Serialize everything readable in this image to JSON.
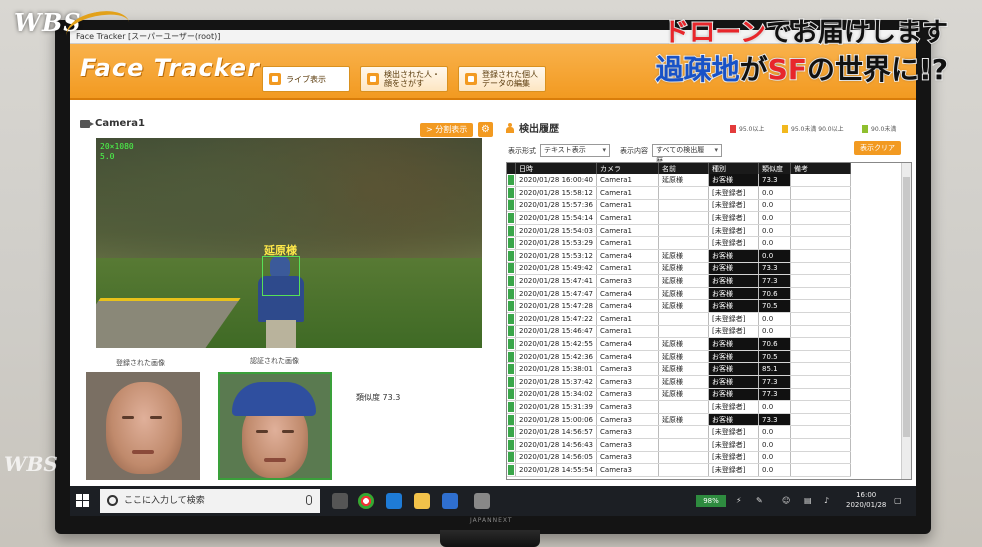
{
  "window": {
    "title": "Face Tracker [スーパーユーザー(root)]"
  },
  "app": {
    "logo": "Face Tracker"
  },
  "nav": [
    {
      "label": "ライブ表示"
    },
    {
      "label": "検出された人・顔をさがす"
    },
    {
      "label": "登録された個人データの編集"
    }
  ],
  "camera": {
    "title": "Camera1",
    "split_label": "> 分割表示",
    "resolution": "20×1080",
    "fps": "5.0",
    "detected_name": "延原様"
  },
  "thumbnails": {
    "registered_label": "登録された画像",
    "detected_label": "認証された画像",
    "similarity_text": "類似度 73.3"
  },
  "history": {
    "title": "検出履歴",
    "legend": [
      {
        "label": "95.0以上",
        "color": "#e33b3b"
      },
      {
        "label": "95.0未満 90.0以上",
        "color": "#f2b81e"
      },
      {
        "label": "90.0未満",
        "color": "#8fbf2f"
      }
    ],
    "display_format_label": "表示形式",
    "display_format_value": "テキスト表示",
    "display_content_label": "表示内容",
    "display_content_value": "すべての検出履歴",
    "clear_label": "表示クリア",
    "columns": [
      "日時",
      "カメラ",
      "名前",
      "種別",
      "類似度",
      "備考"
    ],
    "rows": [
      [
        "2020/01/28 16:00:40",
        "Camera1",
        "延原様",
        "お客様",
        "73.3",
        ""
      ],
      [
        "2020/01/28 15:58:12",
        "Camera1",
        "",
        "[未登録者]",
        "0.0",
        ""
      ],
      [
        "2020/01/28 15:57:36",
        "Camera1",
        "",
        "[未登録者]",
        "0.0",
        ""
      ],
      [
        "2020/01/28 15:54:14",
        "Camera1",
        "",
        "[未登録者]",
        "0.0",
        ""
      ],
      [
        "2020/01/28 15:54:03",
        "Camera1",
        "",
        "[未登録者]",
        "0.0",
        ""
      ],
      [
        "2020/01/28 15:53:29",
        "Camera1",
        "",
        "[未登録者]",
        "0.0",
        ""
      ],
      [
        "2020/01/28 15:53:12",
        "Camera4",
        "延原様",
        "お客様",
        "0.0",
        ""
      ],
      [
        "2020/01/28 15:49:42",
        "Camera1",
        "延原様",
        "お客様",
        "73.3",
        ""
      ],
      [
        "2020/01/28 15:47:41",
        "Camera3",
        "延原様",
        "お客様",
        "77.3",
        ""
      ],
      [
        "2020/01/28 15:47:47",
        "Camera4",
        "延原様",
        "お客様",
        "70.6",
        ""
      ],
      [
        "2020/01/28 15:47:28",
        "Camera4",
        "延原様",
        "お客様",
        "70.5",
        ""
      ],
      [
        "2020/01/28 15:47:22",
        "Camera1",
        "",
        "[未登録者]",
        "0.0",
        ""
      ],
      [
        "2020/01/28 15:46:47",
        "Camera1",
        "",
        "[未登録者]",
        "0.0",
        ""
      ],
      [
        "2020/01/28 15:42:55",
        "Camera4",
        "延原様",
        "お客様",
        "70.6",
        ""
      ],
      [
        "2020/01/28 15:42:36",
        "Camera4",
        "延原様",
        "お客様",
        "70.5",
        ""
      ],
      [
        "2020/01/28 15:38:01",
        "Camera3",
        "延原様",
        "お客様",
        "85.1",
        ""
      ],
      [
        "2020/01/28 15:37:42",
        "Camera3",
        "延原様",
        "お客様",
        "77.3",
        ""
      ],
      [
        "2020/01/28 15:34:02",
        "Camera3",
        "延原様",
        "お客様",
        "77.3",
        ""
      ],
      [
        "2020/01/28 15:31:39",
        "Camera3",
        "",
        "[未登録者]",
        "0.0",
        ""
      ],
      [
        "2020/01/28 15:00:06",
        "Camera3",
        "延原様",
        "お客様",
        "73.3",
        ""
      ],
      [
        "2020/01/28 14:56:57",
        "Camera3",
        "",
        "[未登録者]",
        "0.0",
        ""
      ],
      [
        "2020/01/28 14:56:43",
        "Camera3",
        "",
        "[未登録者]",
        "0.0",
        ""
      ],
      [
        "2020/01/28 14:56:05",
        "Camera3",
        "",
        "[未登録者]",
        "0.0",
        ""
      ],
      [
        "2020/01/28 14:55:54",
        "Camera3",
        "",
        "[未登録者]",
        "0.0",
        ""
      ]
    ]
  },
  "taskbar": {
    "search_placeholder": "ここに入力して検索",
    "battery": "98%",
    "time": "16:00",
    "date": "2020/01/28"
  },
  "broadcast": {
    "logo": "WBS",
    "caption_line1_a": "ドローン",
    "caption_line1_b": "でお届けします",
    "caption_line2_a": "過疎地",
    "caption_line2_b": "が",
    "caption_line2_c": "SF",
    "caption_line2_d": "の世界",
    "caption_line2_e": "に!?"
  },
  "tv": {
    "brand": "JAPANNEXT"
  }
}
